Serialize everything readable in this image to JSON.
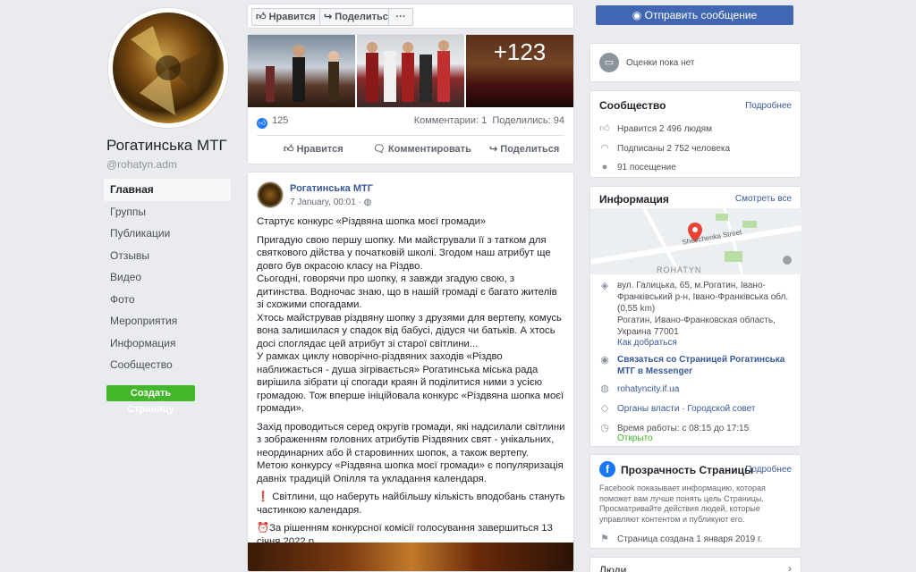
{
  "page": {
    "name": "Рогатинська МТГ",
    "handle": "@rohatyn.adm"
  },
  "nav": {
    "items": [
      {
        "label": "Главная"
      },
      {
        "label": "Группы"
      },
      {
        "label": "Публикации"
      },
      {
        "label": "Отзывы"
      },
      {
        "label": "Видео"
      },
      {
        "label": "Фото"
      },
      {
        "label": "Мероприятия"
      },
      {
        "label": "Информация"
      },
      {
        "label": "Сообщество"
      }
    ],
    "create_page_label": "Создать Страницу"
  },
  "topbar": {
    "like_label": "Нравится",
    "share_label": "Поделиться",
    "more_label": "···",
    "send_message_label": "Отправить сообщение"
  },
  "post1": {
    "more_photos": "+123",
    "reaction_count": "125",
    "comments": "Комментарии: 1",
    "shares": "Поделились: 94",
    "like_action": "Нравится",
    "comment_action": "Комментировать",
    "share_action": "Поделиться"
  },
  "post2": {
    "author": "Рогатинська МТГ",
    "date": "7 January, 00:01 · ",
    "paragraphs": [
      "Стартує конкурс «Різдвяна шопка моєї громади»",
      "Пригадую свою першу шопку. Ми майстрували її з татком для святкового дійства у початковій школі. Згодом наш атрибут ще довго був окрасою класу на Різдво.\nСьогодні, говорячи про шопку, я завжди згадую свою, з дитинства. Водночас знаю, що в нашій громаді є багато жителів зі схожими спогадами.\nХтось майстрував різдвяну шопку з друзями для вертепу, комусь вона залишилася у спадок від бабусі, дідуся чи батьків. А хтось досі споглядає цей атрибут зі старої світлини...\nУ рамках циклу новорічно-різдвяних заходів «Різдво наближається - душа зігрівається» Рогатинська міська рада вирішила зібрати ці спогади краян й поділитися ними з усією громадою. Тож вперше ініційовала конкурс «Різдвяна шопка моєї громади».",
      "Захід проводиться серед округів громади, які надсилали світлини з зображенням головних атрибутів Різдвяних свят - унікальних, неординарних або й старовинних шопок, а також вертепу.\nМетою конкурсу «Різдвяна шопка моєї громади» є популяризація давніх традицій Опілля та укладання календаря.",
      "❗ Світлини, що наберуть найбільшу кількість вподобань стануть частинкою календаря.",
      "⏰За рішенням конкурсної комісії голосування завершиться 13 січня 2022 р."
    ]
  },
  "rating": {
    "label": "Оценки пока нет"
  },
  "community": {
    "title": "Сообщество",
    "link": "Подробнее",
    "likes": "Нравится 2 496 людям",
    "followers": "Подписаны 2 752 человека",
    "checkins": "91 посещение"
  },
  "info": {
    "title": "Информация",
    "link": "Смотреть все",
    "map_street": "Shevchenka Street",
    "map_town": "ROHATYN",
    "address": "вул. Галицька, 65, м.Рогатин, Івано-Франківський р-н, Івано-Франківська обл. (0,55 km)\nРогатин, Ивано-Франковская область, Украина 77001",
    "directions": "Как добраться",
    "messenger": "Связаться со Страницей Рогатинська МТГ в Messenger",
    "website": "rohatyncity.if.ua",
    "category": "Органы власти · Городской совет",
    "hours": "Время работы: с 08:15 до 17:15",
    "open_status": "Открыто"
  },
  "transparency": {
    "title": "Прозрачность Страницы",
    "link": "Подробнее",
    "description": "Facebook показывает информацию, которая поможет вам лучше понять цель Страницы. Просматривайте действия людей, которые управляют контентом и публикуют его.",
    "created": "Страница создана 1 января 2019 г."
  },
  "people": {
    "title": "Люди"
  },
  "colors": {
    "facebook_blue": "#4267b2",
    "link_blue": "#385898",
    "green": "#42b72a",
    "open_green": "#42b72a",
    "map_pin": "#e94235"
  }
}
